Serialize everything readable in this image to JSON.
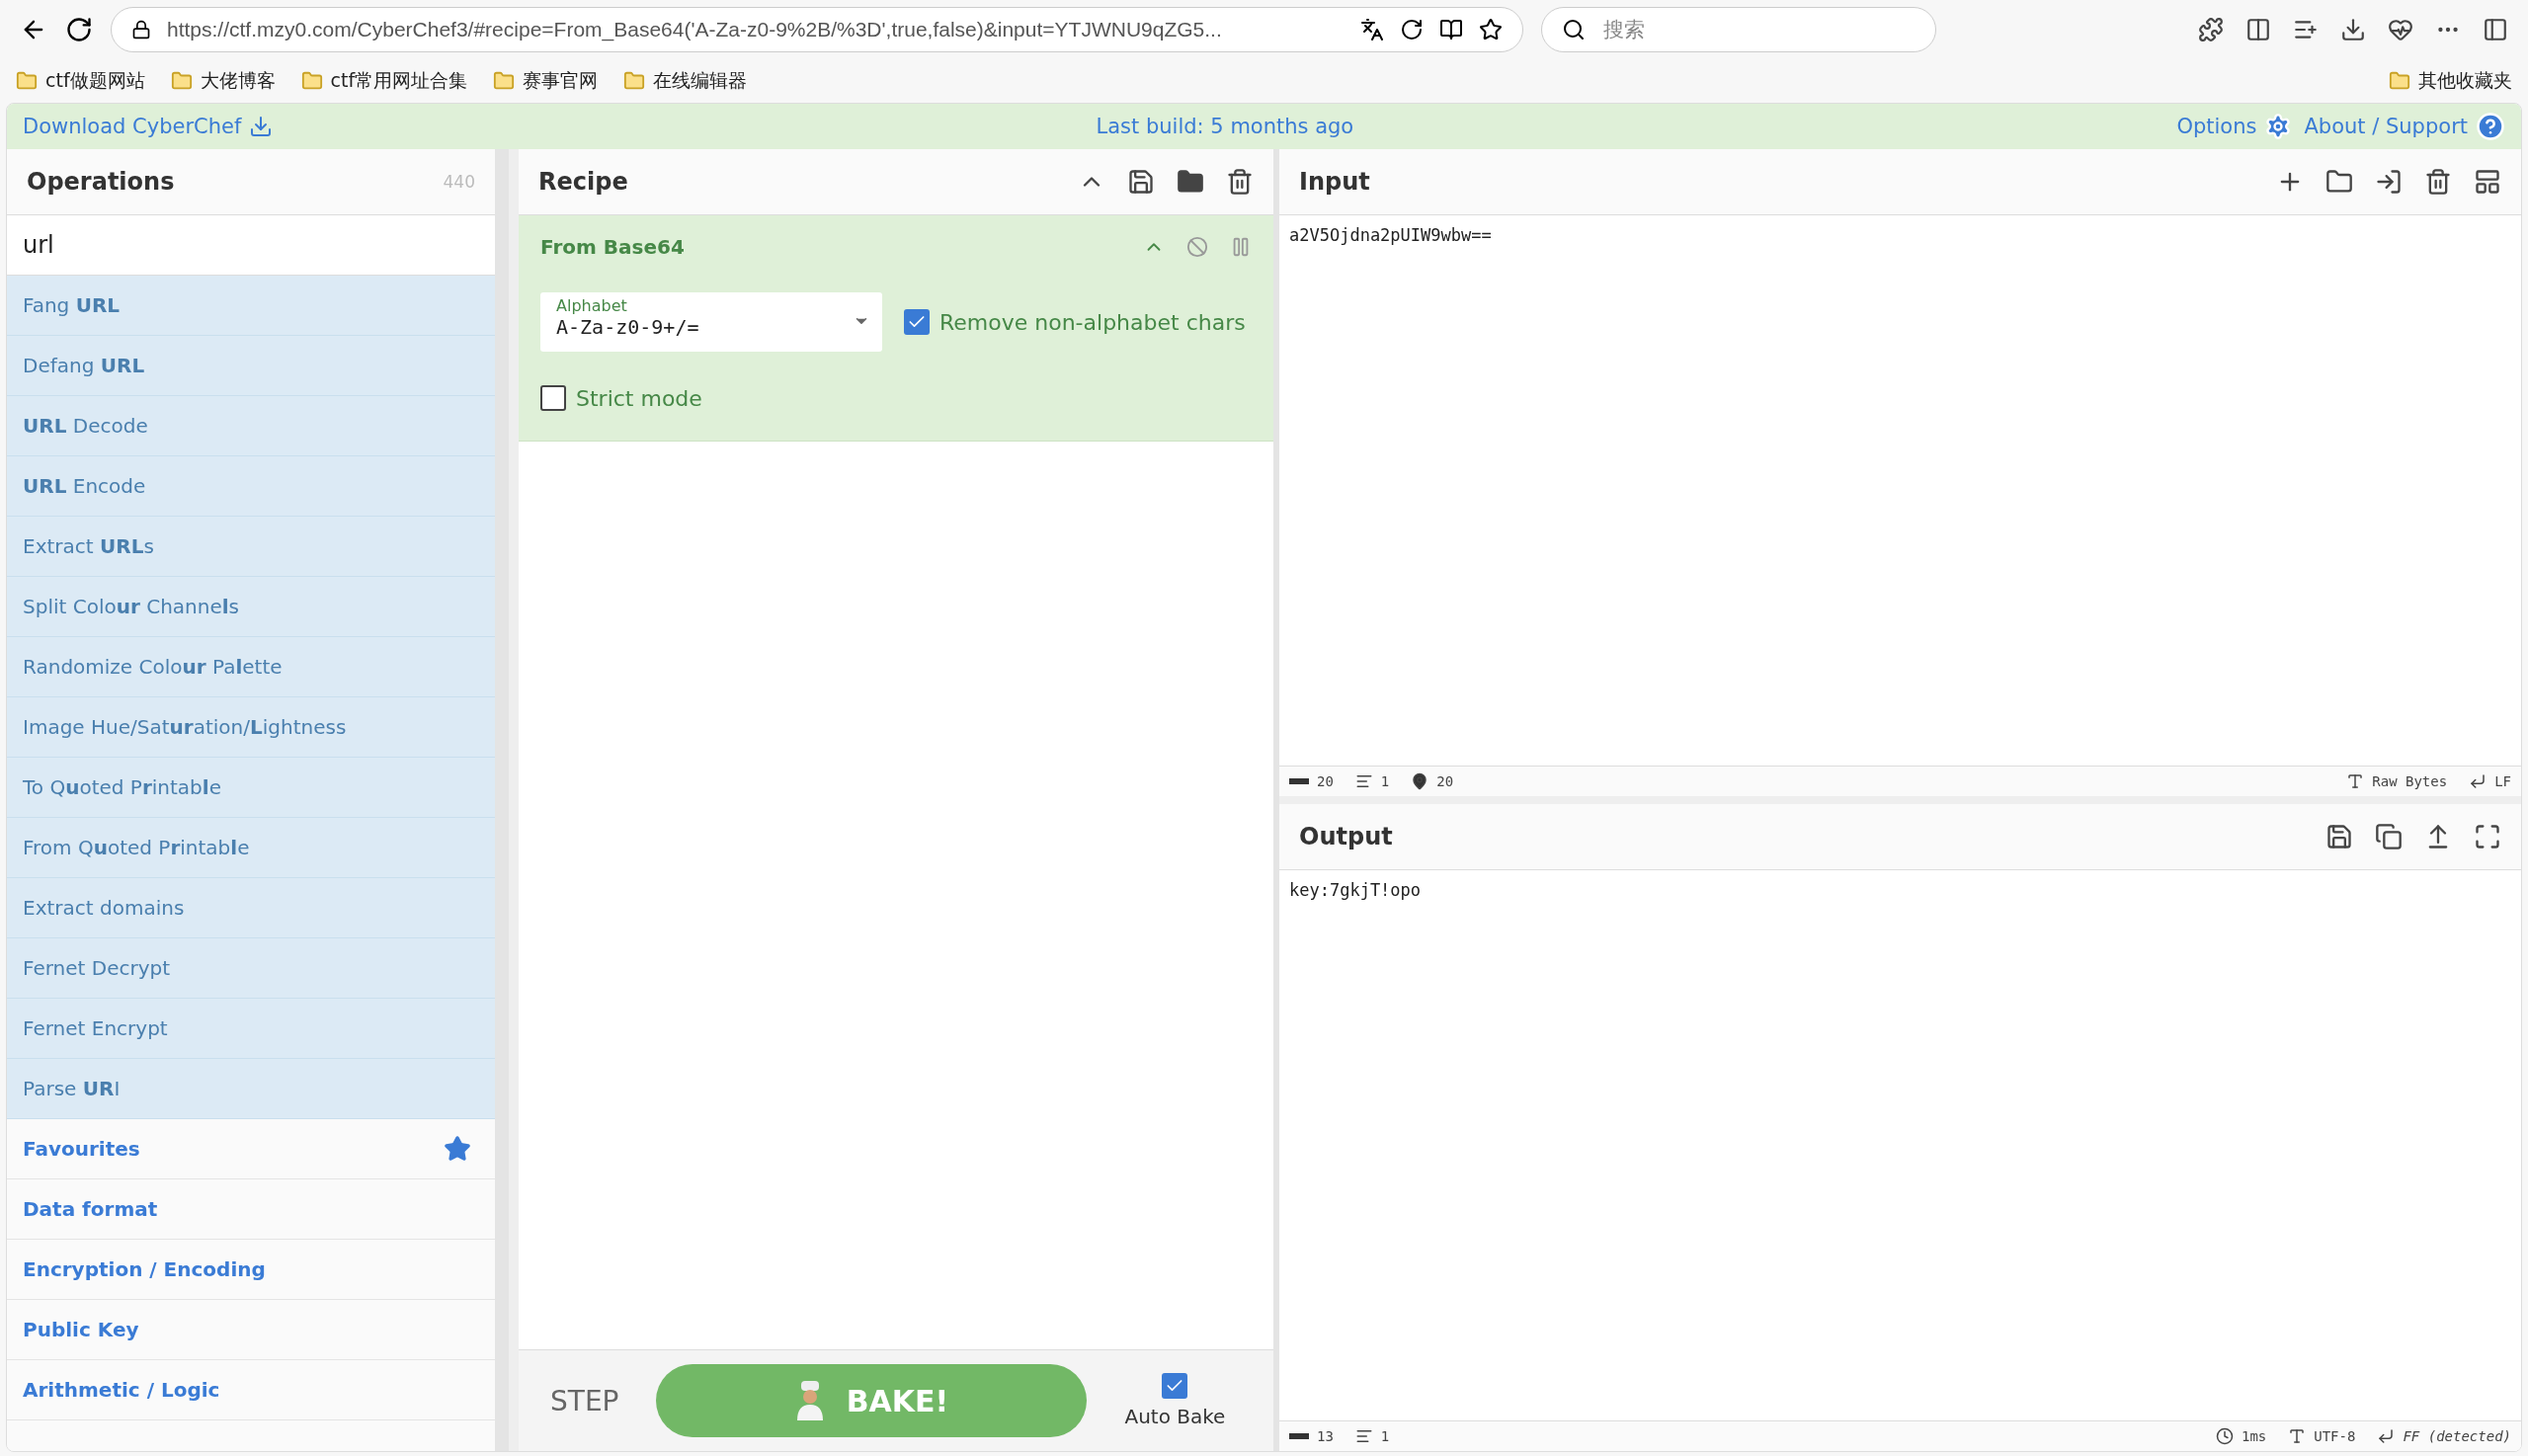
{
  "browser": {
    "url": "https://ctf.mzy0.com/CyberChef3/#recipe=From_Base64('A-Za-z0-9%2B/%3D',true,false)&input=YTJWNU9qZG5...",
    "search_placeholder": "搜索",
    "bookmarks": [
      {
        "label": "ctf做题网站"
      },
      {
        "label": "大佬博客"
      },
      {
        "label": "ctf常用网址合集"
      },
      {
        "label": "赛事官网"
      },
      {
        "label": "在线编辑器"
      }
    ],
    "other_bookmarks": "其他收藏夹"
  },
  "header": {
    "download": "Download CyberChef",
    "build": "Last build: 5 months ago",
    "options": "Options",
    "about": "About / Support"
  },
  "operations": {
    "title": "Operations",
    "count": "440",
    "search": "url",
    "results": [
      {
        "label": "Fang **URL**"
      },
      {
        "label": "Defang **URL**"
      },
      {
        "label": "**URL** Decode"
      },
      {
        "label": "**URL** Encode"
      },
      {
        "label": "Extract **URL**s"
      },
      {
        "label": "Split Colo**ur** Channe**l**s"
      },
      {
        "label": "Randomize Colo**ur** Pa**l**ette"
      },
      {
        "label": "Image Hue/Sat**ur**ation/**L**ightness"
      },
      {
        "label": "To Q**u**oted P**r**intab**l**e"
      },
      {
        "label": "From Q**u**oted P**r**intab**l**e"
      },
      {
        "label": "Extract domains"
      },
      {
        "label": "Fernet Decrypt"
      },
      {
        "label": "Fernet Encrypt"
      },
      {
        "label": "Parse **UR**I"
      }
    ],
    "categories": [
      {
        "label": "Favourites",
        "starred": true
      },
      {
        "label": "Data format",
        "starred": false
      },
      {
        "label": "Encryption / Encoding",
        "starred": false
      },
      {
        "label": "Public Key",
        "starred": false
      },
      {
        "label": "Arithmetic / Logic",
        "starred": false
      }
    ]
  },
  "recipe": {
    "title": "Recipe",
    "operation": {
      "name": "From Base64",
      "alphabet_label": "Alphabet",
      "alphabet": "A-Za-z0-9+/=",
      "options": [
        {
          "label": "Remove non-alphabet chars",
          "checked": true
        },
        {
          "label": "Strict mode",
          "checked": false
        }
      ]
    },
    "step": "STEP",
    "bake": "BAKE!",
    "auto_bake": {
      "label": "Auto Bake",
      "checked": true
    }
  },
  "input": {
    "title": "Input",
    "value": "a2V5Ojdna2pUIW9wbw==",
    "stats": [
      {
        "kind": "length",
        "value": "20"
      },
      {
        "kind": "lines",
        "value": "1"
      },
      {
        "kind": "position",
        "value": "20"
      }
    ],
    "format": "Raw Bytes",
    "eol": "LF"
  },
  "output": {
    "title": "Output",
    "value": "key:7gkjT!opo",
    "stats": [
      {
        "kind": "length",
        "value": "13"
      },
      {
        "kind": "lines",
        "value": "1"
      }
    ],
    "time": "1ms",
    "encoding": "UTF-8",
    "eol": "FF (detected)"
  }
}
